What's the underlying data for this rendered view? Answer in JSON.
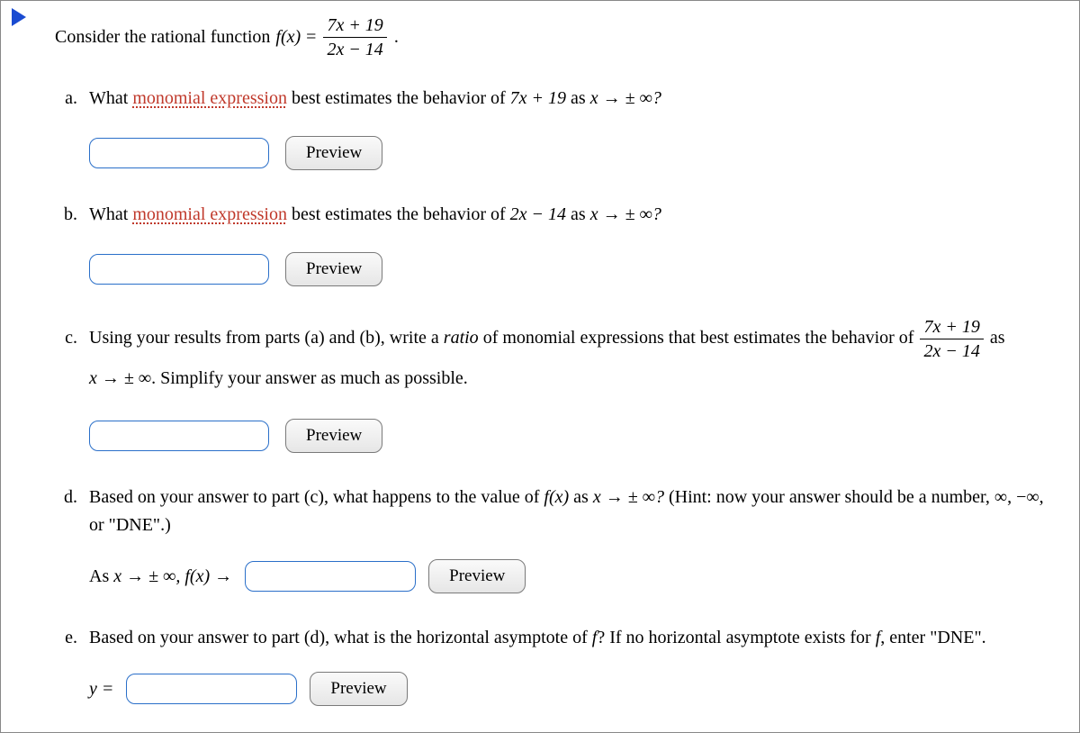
{
  "intro": {
    "lead": "Consider the rational function ",
    "fx": "f(x)",
    "equals": " = ",
    "frac_num": "7x + 19",
    "frac_den": "2x − 14",
    "period": "."
  },
  "parts": {
    "a": {
      "pre": "What ",
      "link": "monomial expression",
      "post1": " best estimates the behavior of ",
      "expr": "7x + 19",
      "post2": " as ",
      "limit": "x →  ± ∞?",
      "preview": "Preview"
    },
    "b": {
      "pre": "What ",
      "link": "monomial expression",
      "post1": " best estimates the behavior of ",
      "expr": "2x − 14",
      "post2": " as ",
      "limit": "x →  ± ∞?",
      "preview": "Preview"
    },
    "c": {
      "pre": "Using your results from parts (a) and (b), write a ",
      "ratio": "ratio",
      "post1": " of monomial expressions that best estimates the behavior of ",
      "frac_num": "7x + 19",
      "frac_den": "2x − 14",
      "post2": " as ",
      "limit": "x →  ± ∞",
      "post3": ". Simplify your answer as much as possible.",
      "preview": "Preview"
    },
    "d": {
      "pre": "Based on your answer to part (c), what happens to the value of ",
      "fx": "f(x)",
      "post1": " as ",
      "limit": "x →  ± ∞?",
      "hint": " (Hint: now your answer should be a number, ∞, −∞, or \"DNE\".)",
      "inline_prefix": "As ",
      "inline_limit": "x →  ± ∞, ",
      "inline_fx": "f(x)",
      "inline_arrow": " → ",
      "preview": "Preview"
    },
    "e": {
      "pre": "Based on your answer to part (d), what is the horizontal asymptote of ",
      "f": "f",
      "post1": "? If no horizontal asymptote exists for ",
      "f2": "f",
      "post2": ", enter \"DNE\".",
      "y_eq": "y = ",
      "preview": "Preview"
    }
  }
}
